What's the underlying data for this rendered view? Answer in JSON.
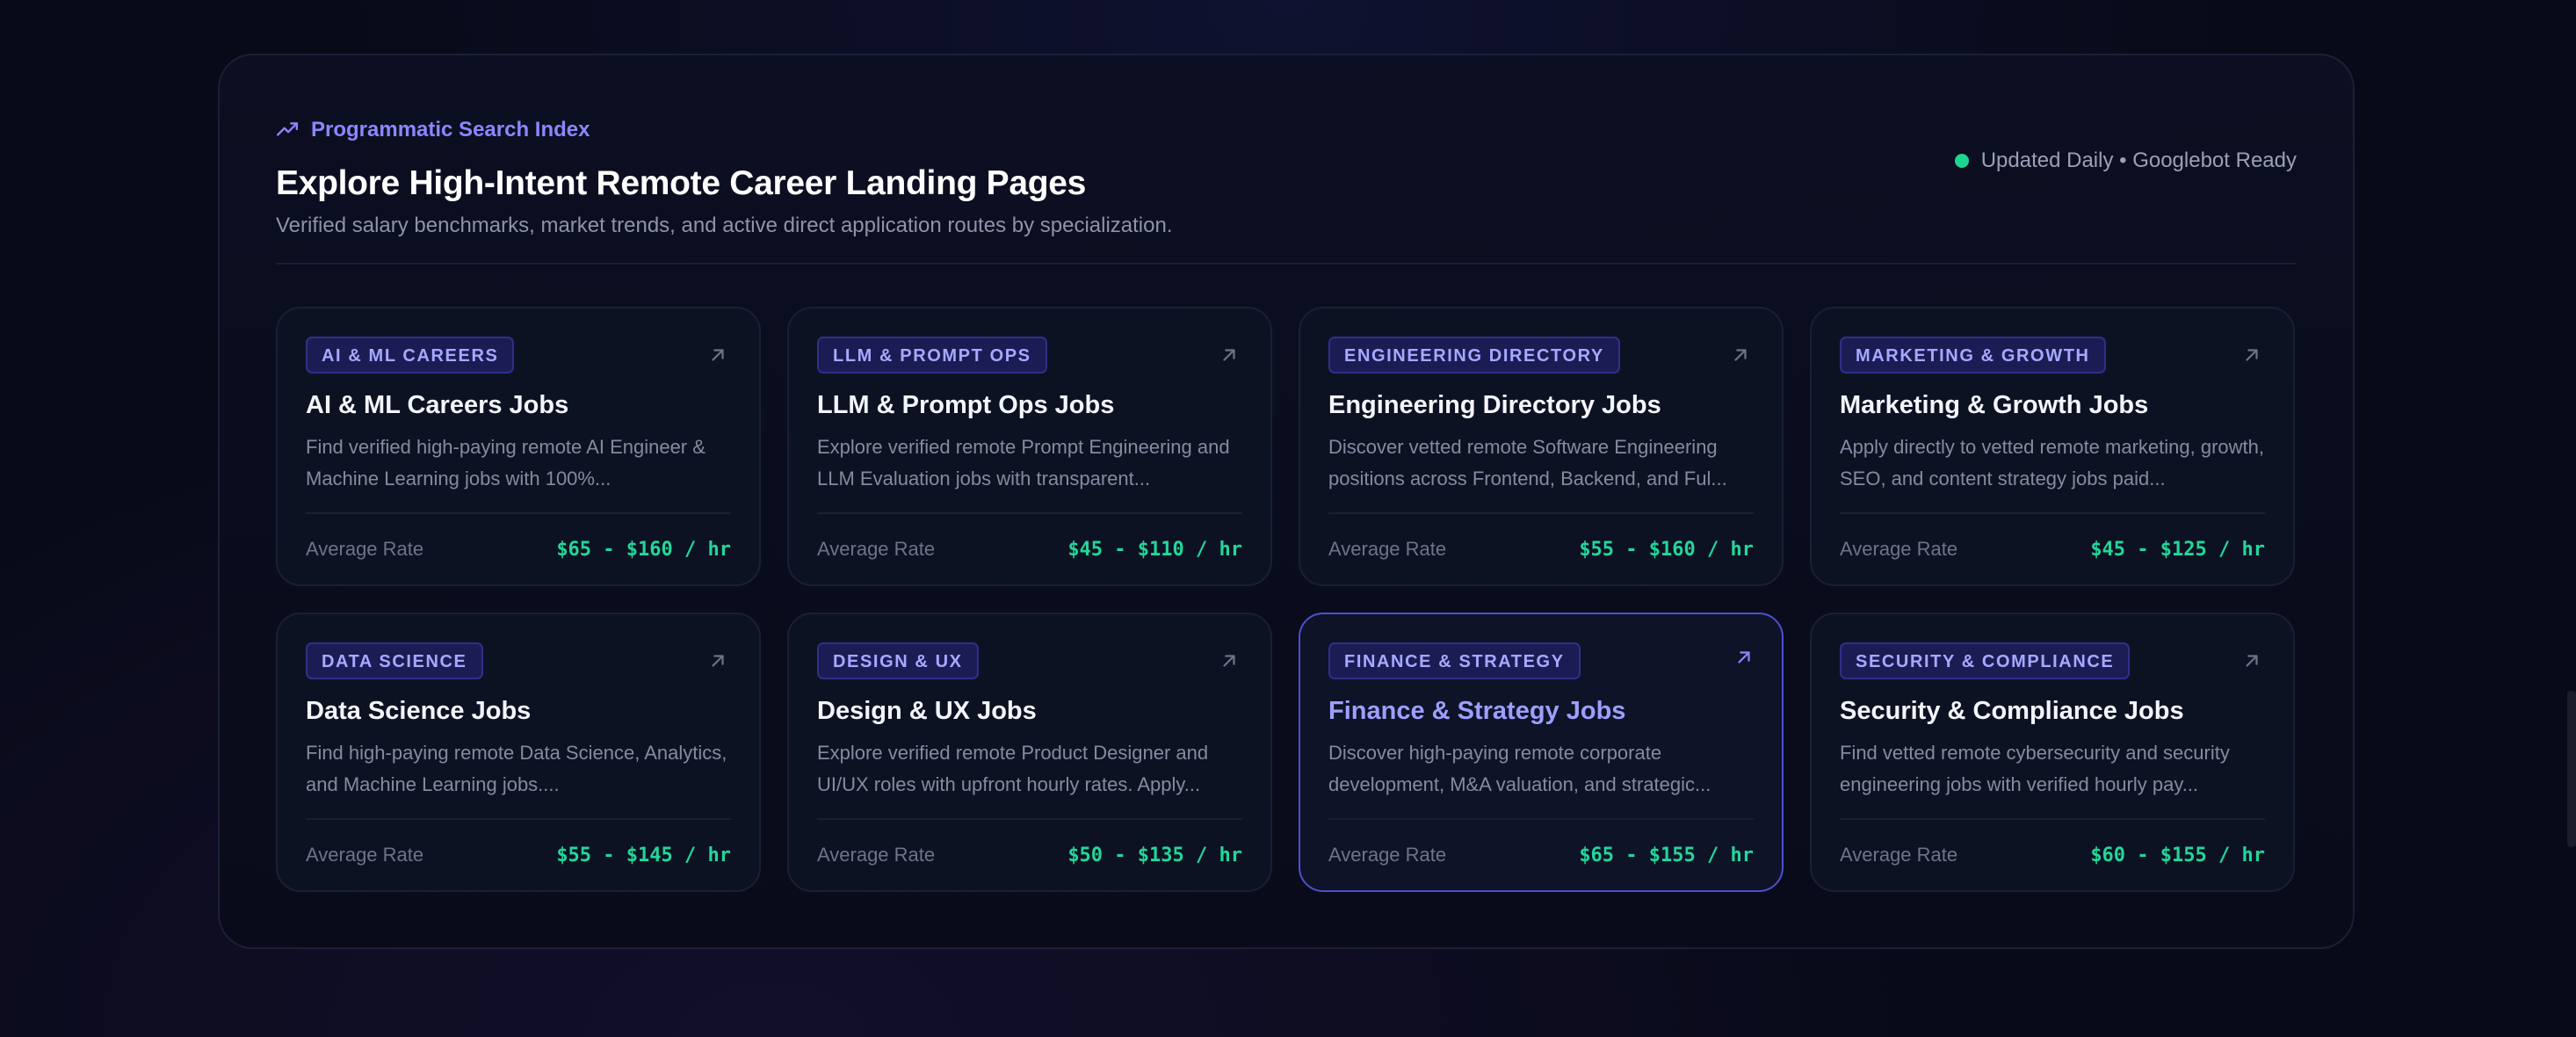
{
  "header": {
    "eyebrow": "Programmatic Search Index",
    "title": "Explore High-Intent Remote Career Landing Pages",
    "subtitle": "Verified salary benchmarks, market trends, and active direct application routes by specialization.",
    "status": "Updated Daily • Googlebot Ready"
  },
  "colors": {
    "accent": "#8b87ff",
    "rate": "#22d79a",
    "status_dot": "#1ed58f"
  },
  "cards": [
    {
      "badge": "AI & ML CAREERS",
      "title": "AI & ML Careers Jobs",
      "desc": "Find verified high-paying remote AI Engineer & Machine Learning jobs with 100%...",
      "rate_label": "Average Rate",
      "rate": "$65 - $160 / hr"
    },
    {
      "badge": "LLM & PROMPT OPS",
      "title": "LLM & Prompt Ops Jobs",
      "desc": "Explore verified remote Prompt Engineering and LLM Evaluation jobs with transparent...",
      "rate_label": "Average Rate",
      "rate": "$45 - $110 / hr"
    },
    {
      "badge": "ENGINEERING DIRECTORY",
      "title": "Engineering Directory Jobs",
      "desc": "Discover vetted remote Software Engineering positions across Frontend, Backend, and Ful...",
      "rate_label": "Average Rate",
      "rate": "$55 - $160 / hr"
    },
    {
      "badge": "MARKETING & GROWTH",
      "title": "Marketing & Growth Jobs",
      "desc": "Apply directly to vetted remote marketing, growth, SEO, and content strategy jobs paid...",
      "rate_label": "Average Rate",
      "rate": "$45 - $125 / hr"
    },
    {
      "badge": "DATA SCIENCE",
      "title": "Data Science Jobs",
      "desc": "Find high-paying remote Data Science, Analytics, and Machine Learning jobs....",
      "rate_label": "Average Rate",
      "rate": "$55 - $145 / hr"
    },
    {
      "badge": "DESIGN & UX",
      "title": "Design & UX Jobs",
      "desc": "Explore verified remote Product Designer and UI/UX roles with upfront hourly rates. Apply...",
      "rate_label": "Average Rate",
      "rate": "$50 - $135 / hr"
    },
    {
      "badge": "FINANCE & STRATEGY",
      "title": "Finance & Strategy Jobs",
      "desc": "Discover high-paying remote corporate development, M&A valuation, and strategic...",
      "rate_label": "Average Rate",
      "rate": "$65 - $155 / hr"
    },
    {
      "badge": "SECURITY & COMPLIANCE",
      "title": "Security & Compliance Jobs",
      "desc": "Find vetted remote cybersecurity and security engineering jobs with verified hourly pay...",
      "rate_label": "Average Rate",
      "rate": "$60 - $155 / hr"
    }
  ]
}
